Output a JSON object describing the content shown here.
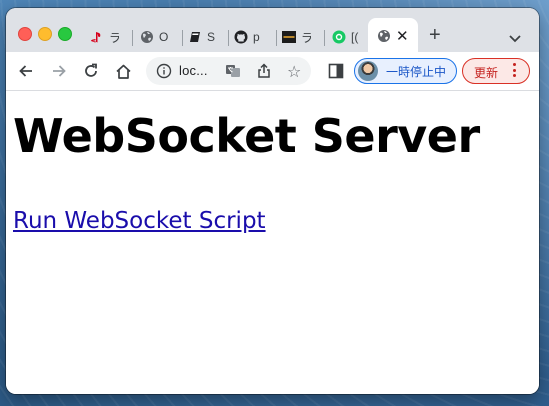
{
  "browser": {
    "tabs": [
      {
        "title": "ラ",
        "icon": "playstation-icon"
      },
      {
        "title": "O",
        "icon": "globe-icon"
      },
      {
        "title": "S",
        "icon": "book-icon"
      },
      {
        "title": "p",
        "icon": "github-icon"
      },
      {
        "title": "ラ",
        "icon": "site-logo-icon"
      },
      {
        "title": "[(",
        "icon": "green-circle-icon"
      }
    ],
    "active_tab": {
      "icon": "globe-icon",
      "close": "✕"
    },
    "new_tab": "+",
    "address": "loc...",
    "profile_label": "一時停止中",
    "update_label": "更新"
  },
  "page": {
    "heading": "WebSocket Server",
    "link_text": "Run WebSocket Script"
  },
  "colors": {
    "link": "#1a0dab",
    "profile_accent": "#1a73e8",
    "update_accent": "#d93025"
  }
}
